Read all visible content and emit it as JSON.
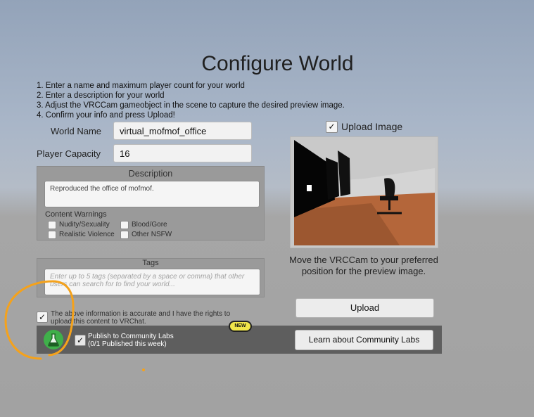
{
  "page_title": "Configure World",
  "instructions": [
    "1. Enter a name and maximum player count for your world",
    "2. Enter a description for your world",
    "3. Adjust the VRCCam gameobject in the scene to capture the desired preview image.",
    "4. Confirm your info and press Upload!"
  ],
  "world_name": {
    "label": "World Name",
    "value": "virtual_mofmof_office"
  },
  "player_capacity": {
    "label": "Player Capacity",
    "value": "16"
  },
  "description": {
    "header": "Description",
    "value": "Reproduced the office of mofmof."
  },
  "content_warnings": {
    "label": "Content Warnings",
    "options": [
      {
        "label": "Nudity/Sexuality",
        "checked": false
      },
      {
        "label": "Blood/Gore",
        "checked": false
      },
      {
        "label": "Realistic Violence",
        "checked": false
      },
      {
        "label": "Other NSFW",
        "checked": false
      }
    ]
  },
  "tags": {
    "header": "Tags",
    "placeholder": "Enter up to 5 tags (separated by a space or comma) that other users can search for to find your world..."
  },
  "rights_confirm": {
    "text": "The above information is accurate and I have the rights to upload this content to VRChat.",
    "checked": true
  },
  "community_labs": {
    "badge": "NEW",
    "title": "Publish to Community Labs",
    "subtitle": "(0/1 Published this week)",
    "checked": true,
    "learn_button": "Learn about Community Labs"
  },
  "upload_image": {
    "label": "Upload Image",
    "checked": true
  },
  "preview_caption": "Move the VRCCam to your preferred position for the preview image.",
  "upload_button": "Upload",
  "colors": {
    "labs_bar": "#5e5e5e",
    "badge": "#f0e64a",
    "annotation": "#f5a21b",
    "labs_icon": "#3fb04a"
  }
}
